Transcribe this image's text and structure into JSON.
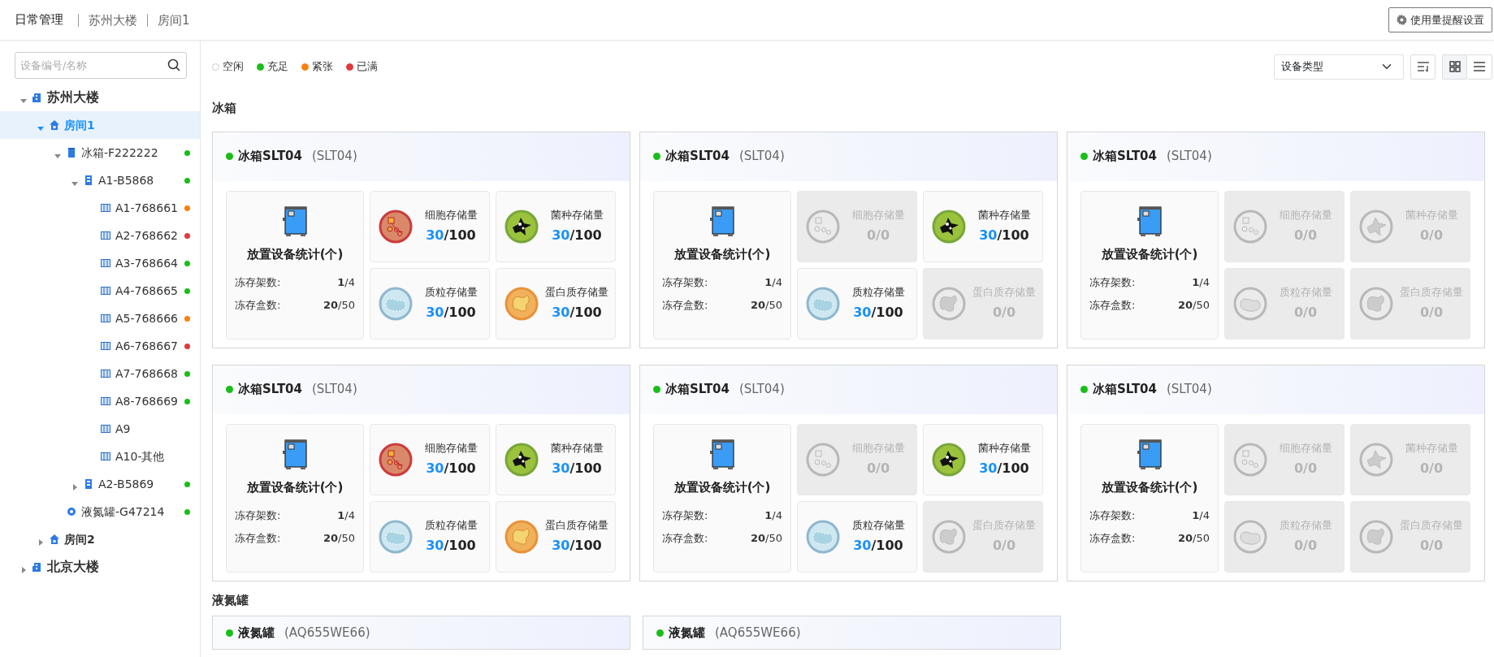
{
  "topbar": {
    "title": "日常管理",
    "breadcrumbs": [
      "苏州大楼",
      "房间1"
    ],
    "settings_button": "使用量提醒设置"
  },
  "sidebar": {
    "search": {
      "placeholder": "设备编号/名称"
    },
    "tree": [
      {
        "kind": "building",
        "label": "苏州大楼",
        "expanded": true,
        "selected": false,
        "children": [
          {
            "kind": "room",
            "label": "房间1",
            "expanded": true,
            "selected": true,
            "children": [
              {
                "kind": "fridge",
                "label": "冰箱-F222222",
                "expanded": true,
                "selected": false,
                "color": "#19be19",
                "children": [
                  {
                    "kind": "rack",
                    "label": "A1-B5868",
                    "expanded": true,
                    "selected": false,
                    "color": "#19be19",
                    "children": [
                      {
                        "kind": "box",
                        "label": "A1-768661",
                        "selected": false,
                        "color": "#f5820f"
                      },
                      {
                        "kind": "box",
                        "label": "A2-768662",
                        "selected": false,
                        "color": "#e03a3a"
                      },
                      {
                        "kind": "box",
                        "label": "A3-768664",
                        "selected": false,
                        "color": "#19be19"
                      },
                      {
                        "kind": "box",
                        "label": "A4-768665",
                        "selected": false,
                        "color": "#19be19"
                      },
                      {
                        "kind": "box",
                        "label": "A5-768666",
                        "selected": false,
                        "color": "#f5820f"
                      },
                      {
                        "kind": "box",
                        "label": "A6-768667",
                        "selected": false,
                        "color": "#e03a3a"
                      },
                      {
                        "kind": "box",
                        "label": "A7-768668",
                        "selected": false,
                        "color": "#19be19"
                      },
                      {
                        "kind": "box",
                        "label": "A8-768669",
                        "selected": false,
                        "color": "#19be19"
                      },
                      {
                        "kind": "box",
                        "label": "A9",
                        "selected": false
                      },
                      {
                        "kind": "box",
                        "label": "A10-其他",
                        "selected": false
                      }
                    ]
                  },
                  {
                    "kind": "rack",
                    "label": "A2-B5869",
                    "expanded": false,
                    "selected": false,
                    "color": "#19be19"
                  }
                ]
              },
              {
                "kind": "tank",
                "label": "液氮罐-G47214",
                "expanded": true,
                "selected": false,
                "color": "#19be19"
              }
            ]
          },
          {
            "kind": "room",
            "label": "房间2",
            "expanded": false,
            "selected": false
          }
        ]
      },
      {
        "kind": "building",
        "label": "北京大楼",
        "expanded": false,
        "selected": false
      }
    ]
  },
  "legend": [
    {
      "label": "空闲",
      "color": "#ffffff"
    },
    {
      "label": "充足",
      "color": "#19be19"
    },
    {
      "label": "紧张",
      "color": "#f5820f"
    },
    {
      "label": "已满",
      "color": "#e03a3a"
    }
  ],
  "toolbar": {
    "device_type": "设备类型",
    "views": [
      {
        "kind": "grid",
        "selected": true
      },
      {
        "kind": "list",
        "selected": false
      }
    ]
  },
  "sections": [
    {
      "title": "冰箱",
      "cards": [
        {
          "color": "#19be19",
          "name": "冰箱SLT04",
          "code": "(SLT04)",
          "stat_title": "放置设备统计(个)",
          "stats": [
            {
              "label": "冻存架数:",
              "value": "**1**/4"
            },
            {
              "label": "冻存盒数:",
              "value": "**20**/50"
            }
          ],
          "tiles": [
            {
              "kind": "cell",
              "label": "细胞存储量",
              "used": "30",
              "separator": "/",
              "total": "100",
              "enabled": true
            },
            {
              "kind": "strain",
              "label": "菌种存储量",
              "used": "30",
              "separator": "/",
              "total": "100",
              "enabled": true
            },
            {
              "kind": "plasmid",
              "label": "质粒存储量",
              "used": "30",
              "separator": "/",
              "total": "100",
              "enabled": true
            },
            {
              "kind": "protein",
              "label": "蛋白质存储量",
              "used": "30",
              "separator": "/",
              "total": "100",
              "enabled": true
            }
          ]
        },
        {
          "color": "#19be19",
          "name": "冰箱SLT04",
          "code": "(SLT04)",
          "stat_title": "放置设备统计(个)",
          "stats": [
            {
              "label": "冻存架数:",
              "value": "**1**/4"
            },
            {
              "label": "冻存盒数:",
              "value": "**20**/50"
            }
          ],
          "tiles": [
            {
              "kind": "cell",
              "label": "细胞存储量",
              "used": "0",
              "separator": "/",
              "total": "0",
              "enabled": false
            },
            {
              "kind": "strain",
              "label": "菌种存储量",
              "used": "30",
              "separator": "/",
              "total": "100",
              "enabled": true
            },
            {
              "kind": "plasmid",
              "label": "质粒存储量",
              "used": "30",
              "separator": "/",
              "total": "100",
              "enabled": true
            },
            {
              "kind": "protein",
              "label": "蛋白质存储量",
              "used": "0",
              "separator": "/",
              "total": "0",
              "enabled": false
            }
          ]
        },
        {
          "color": "#19be19",
          "name": "冰箱SLT04",
          "code": "(SLT04)",
          "stat_title": "放置设备统计(个)",
          "stats": [
            {
              "label": "冻存架数:",
              "value": "**1**/4"
            },
            {
              "label": "冻存盒数:",
              "value": "**20**/50"
            }
          ],
          "tiles": [
            {
              "kind": "cell",
              "label": "细胞存储量",
              "used": "0",
              "separator": "/",
              "total": "0",
              "enabled": false
            },
            {
              "kind": "strain",
              "label": "菌种存储量",
              "used": "0",
              "separator": "/",
              "total": "0",
              "enabled": false
            },
            {
              "kind": "plasmid",
              "label": "质粒存储量",
              "used": "0",
              "separator": "/",
              "total": "0",
              "enabled": false
            },
            {
              "kind": "protein",
              "label": "蛋白质存储量",
              "used": "0",
              "separator": "/",
              "total": "0",
              "enabled": false
            }
          ]
        },
        {
          "color": "#19be19",
          "name": "冰箱SLT04",
          "code": "(SLT04)",
          "stat_title": "放置设备统计(个)",
          "stats": [
            {
              "label": "冻存架数:",
              "value": "**1**/4"
            },
            {
              "label": "冻存盒数:",
              "value": "**20**/50"
            }
          ],
          "tiles": [
            {
              "kind": "cell",
              "label": "细胞存储量",
              "used": "30",
              "separator": "/",
              "total": "100",
              "enabled": true
            },
            {
              "kind": "strain",
              "label": "菌种存储量",
              "used": "30",
              "separator": "/",
              "total": "100",
              "enabled": true
            },
            {
              "kind": "plasmid",
              "label": "质粒存储量",
              "used": "30",
              "separator": "/",
              "total": "100",
              "enabled": true
            },
            {
              "kind": "protein",
              "label": "蛋白质存储量",
              "used": "30",
              "separator": "/",
              "total": "100",
              "enabled": true
            }
          ]
        },
        {
          "color": "#19be19",
          "name": "冰箱SLT04",
          "code": "(SLT04)",
          "stat_title": "放置设备统计(个)",
          "stats": [
            {
              "label": "冻存架数:",
              "value": "**1**/4"
            },
            {
              "label": "冻存盒数:",
              "value": "**20**/50"
            }
          ],
          "tiles": [
            {
              "kind": "cell",
              "label": "细胞存储量",
              "used": "0",
              "separator": "/",
              "total": "0",
              "enabled": false
            },
            {
              "kind": "strain",
              "label": "菌种存储量",
              "used": "30",
              "separator": "/",
              "total": "100",
              "enabled": true
            },
            {
              "kind": "plasmid",
              "label": "质粒存储量",
              "used": "30",
              "separator": "/",
              "total": "100",
              "enabled": true
            },
            {
              "kind": "protein",
              "label": "蛋白质存储量",
              "used": "0",
              "separator": "/",
              "total": "0",
              "enabled": false
            }
          ]
        },
        {
          "color": "#19be19",
          "name": "冰箱SLT04",
          "code": "(SLT04)",
          "stat_title": "放置设备统计(个)",
          "stats": [
            {
              "label": "冻存架数:",
              "value": "**1**/4"
            },
            {
              "label": "冻存盒数:",
              "value": "**20**/50"
            }
          ],
          "tiles": [
            {
              "kind": "cell",
              "label": "细胞存储量",
              "used": "0",
              "separator": "/",
              "total": "0",
              "enabled": false
            },
            {
              "kind": "strain",
              "label": "菌种存储量",
              "used": "0",
              "separator": "/",
              "total": "0",
              "enabled": false
            },
            {
              "kind": "plasmid",
              "label": "质粒存储量",
              "used": "0",
              "separator": "/",
              "total": "0",
              "enabled": false
            },
            {
              "kind": "protein",
              "label": "蛋白质存储量",
              "used": "0",
              "separator": "/",
              "total": "0",
              "enabled": false
            }
          ]
        }
      ]
    },
    {
      "title": "液氮罐",
      "cards": [
        {
          "color": "#19be19",
          "name": "液氮罐",
          "code": "(AQ655WE66)"
        },
        {
          "color": "#19be19",
          "name": "液氮罐",
          "code": "(AQ655WE66)"
        }
      ]
    }
  ]
}
